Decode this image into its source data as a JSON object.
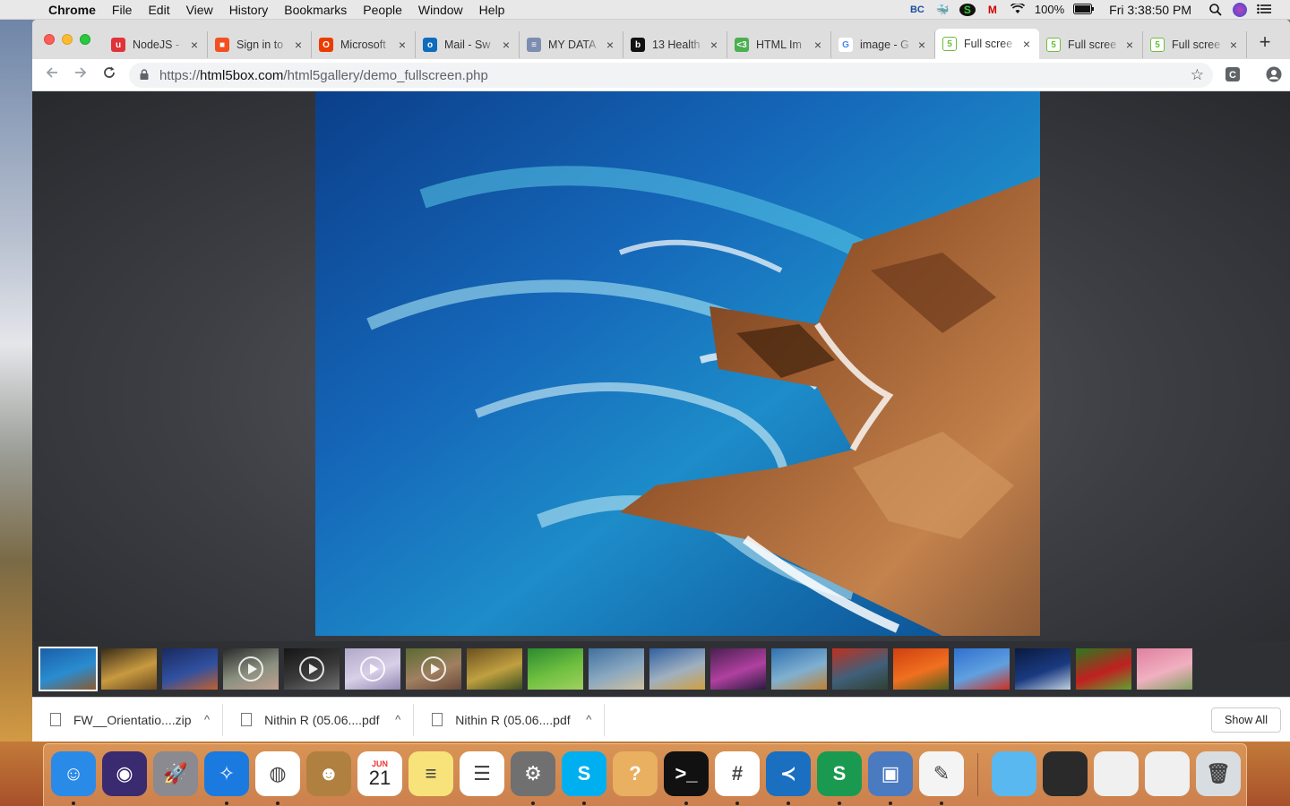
{
  "menubar": {
    "app_name": "Chrome",
    "items": [
      "File",
      "Edit",
      "View",
      "History",
      "Bookmarks",
      "People",
      "Window",
      "Help"
    ],
    "bc_label": "BC",
    "battery": "100%",
    "clock": "Fri 3:38:50 PM"
  },
  "tabs": [
    {
      "title": "NodeJS - ",
      "favicon": "udemy-icon",
      "color": "#e0333a",
      "glyph": "u"
    },
    {
      "title": "Sign in to",
      "favicon": "microsoft-icon",
      "color": "#f25022",
      "glyph": "■"
    },
    {
      "title": "Microsoft",
      "favicon": "office-icon",
      "color": "#eb3c00",
      "glyph": "O"
    },
    {
      "title": "Mail - Sw",
      "favicon": "outlook-icon",
      "color": "#0f6cbd",
      "glyph": "o"
    },
    {
      "title": "MY DATA",
      "favicon": "data-icon",
      "color": "#7c8db0",
      "glyph": "≡"
    },
    {
      "title": "13 Health",
      "favicon": "medium-icon",
      "color": "#111111",
      "glyph": "b"
    },
    {
      "title": "HTML Im",
      "favicon": "html-icon",
      "color": "#4caf50",
      "glyph": "<3"
    },
    {
      "title": "image - G",
      "favicon": "google-icon",
      "color": "#4285f4",
      "glyph": "G"
    },
    {
      "title": "Full scree",
      "favicon": "html5box-icon",
      "color": "#6cbf3c",
      "glyph": "5",
      "active": true
    },
    {
      "title": "Full scree",
      "favicon": "html5box-icon",
      "color": "#6cbf3c",
      "glyph": "5"
    },
    {
      "title": "Full scree",
      "favicon": "html5box-icon",
      "color": "#6cbf3c",
      "glyph": "5"
    }
  ],
  "address": {
    "scheme": "https://",
    "host": "html5box.com",
    "path": "/html5gallery/demo_fullscreen.php"
  },
  "gallery": {
    "main_image": "rocky-coastline-sea",
    "thumbnails": [
      {
        "name": "thumb-coast",
        "colors": [
          "#1a5fa8",
          "#2a8cd0",
          "#8a5a30"
        ],
        "video": false,
        "selected": true
      },
      {
        "name": "thumb-sunset-cliff",
        "colors": [
          "#3a2c18",
          "#c89a40",
          "#6a4a20"
        ],
        "video": false
      },
      {
        "name": "thumb-city-night",
        "colors": [
          "#1a2a60",
          "#3050a0",
          "#c06030"
        ],
        "video": false
      },
      {
        "name": "thumb-video-1",
        "colors": [
          "#2a2a2a",
          "#8a9080",
          "#c0a090"
        ],
        "video": true
      },
      {
        "name": "thumb-video-2",
        "colors": [
          "#151515",
          "#3a3a3a",
          "#707070"
        ],
        "video": true
      },
      {
        "name": "thumb-video-3",
        "colors": [
          "#b0a8c8",
          "#d8d0e8",
          "#9088b0"
        ],
        "video": true
      },
      {
        "name": "thumb-video-4",
        "colors": [
          "#5a6a30",
          "#a08060",
          "#6a4a3a"
        ],
        "video": true
      },
      {
        "name": "thumb-forest",
        "colors": [
          "#6a5020",
          "#c0a040",
          "#3a5020"
        ],
        "video": false
      },
      {
        "name": "thumb-green-field",
        "colors": [
          "#2a8a30",
          "#70c040",
          "#a0d060"
        ],
        "video": false
      },
      {
        "name": "thumb-beach",
        "colors": [
          "#4070a0",
          "#8aa8c0",
          "#d0c0a0"
        ],
        "video": false
      },
      {
        "name": "thumb-desert-sky",
        "colors": [
          "#3060a0",
          "#a0b0c0",
          "#d0a040"
        ],
        "video": false
      },
      {
        "name": "thumb-purple-sky",
        "colors": [
          "#4a2050",
          "#b040a0",
          "#2a1a40"
        ],
        "video": false
      },
      {
        "name": "thumb-lake-tree",
        "colors": [
          "#3070b0",
          "#80b0d0",
          "#c08030"
        ],
        "video": false
      },
      {
        "name": "thumb-red-sunset",
        "colors": [
          "#c03020",
          "#40607a",
          "#304030"
        ],
        "video": false
      },
      {
        "name": "thumb-tulips-orange",
        "colors": [
          "#d04010",
          "#f07020",
          "#4a6020"
        ],
        "video": false
      },
      {
        "name": "thumb-tulips-sky",
        "colors": [
          "#3070d0",
          "#60a0e0",
          "#d03020"
        ],
        "video": false
      },
      {
        "name": "thumb-swan",
        "colors": [
          "#0a1a40",
          "#1a3a80",
          "#c0d0e0"
        ],
        "video": false
      },
      {
        "name": "thumb-tulips-red",
        "colors": [
          "#2a7a20",
          "#c02020",
          "#60a030"
        ],
        "video": false
      },
      {
        "name": "thumb-cherry-blossom",
        "colors": [
          "#e080a0",
          "#f0b0c0",
          "#80a060"
        ],
        "video": false
      }
    ]
  },
  "downloads": {
    "items": [
      {
        "name": "FW__Orientatio....zip"
      },
      {
        "name": "Nithin R (05.06....pdf"
      },
      {
        "name": "Nithin R (05.06....pdf"
      }
    ],
    "show_all": "Show All"
  },
  "dock": {
    "calendar_month": "JUN",
    "calendar_day": "21",
    "apps": [
      {
        "name": "finder",
        "color": "#2a8ae8",
        "glyph": "☺",
        "running": true
      },
      {
        "name": "siri",
        "color": "#3a2a70",
        "glyph": "◉",
        "running": false
      },
      {
        "name": "launchpad",
        "color": "#8a8a90",
        "glyph": "🚀",
        "running": false
      },
      {
        "name": "safari",
        "color": "#1a7ae0",
        "glyph": "✧",
        "running": true
      },
      {
        "name": "chrome",
        "color": "#ffffff",
        "glyph": "◍",
        "running": true
      },
      {
        "name": "contacts",
        "color": "#b08040",
        "glyph": "☻",
        "running": false
      },
      {
        "name": "calendar",
        "color": "#ffffff",
        "glyph": "",
        "running": false
      },
      {
        "name": "notes",
        "color": "#f7e37a",
        "glyph": "≡",
        "running": false
      },
      {
        "name": "reminders",
        "color": "#ffffff",
        "glyph": "☰",
        "running": false
      },
      {
        "name": "system-preferences",
        "color": "#707070",
        "glyph": "⚙",
        "running": true
      },
      {
        "name": "skype",
        "color": "#00aff0",
        "glyph": "S",
        "running": true
      },
      {
        "name": "help",
        "color": "#e8b060",
        "glyph": "?",
        "running": false
      },
      {
        "name": "terminal",
        "color": "#111111",
        "glyph": ">_",
        "running": true
      },
      {
        "name": "slack",
        "color": "#ffffff",
        "glyph": "#",
        "running": true
      },
      {
        "name": "vscode",
        "color": "#1a6fc0",
        "glyph": "≺",
        "running": true
      },
      {
        "name": "sourcetree",
        "color": "#1a9a50",
        "glyph": "S",
        "running": true
      },
      {
        "name": "preview",
        "color": "#4a7ac0",
        "glyph": "▣",
        "running": true
      },
      {
        "name": "textedit",
        "color": "#f4f4f4",
        "glyph": "✎",
        "running": true
      },
      {
        "name": "downloads-folder",
        "color": "#5ab8f0",
        "glyph": "",
        "running": false
      },
      {
        "name": "recent-window-1",
        "color": "#2a2a2a",
        "glyph": "",
        "running": false
      },
      {
        "name": "recent-window-2",
        "color": "#f0f0f0",
        "glyph": "",
        "running": false
      },
      {
        "name": "recent-window-3",
        "color": "#f0f0f0",
        "glyph": "",
        "running": false
      },
      {
        "name": "trash",
        "color": "#d8dde2",
        "glyph": "🗑",
        "running": false
      }
    ]
  }
}
